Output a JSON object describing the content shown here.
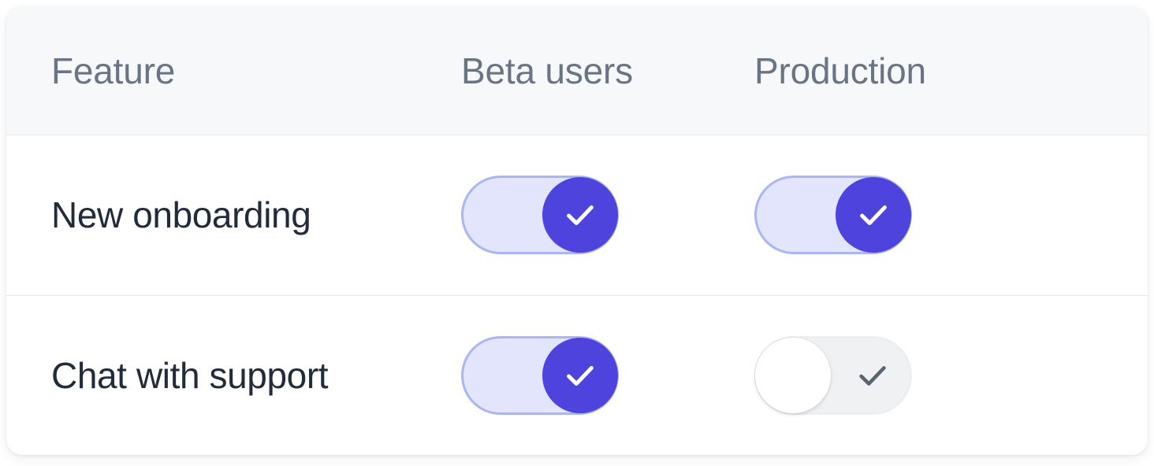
{
  "table": {
    "columns": [
      {
        "key": "feature",
        "label": "Feature"
      },
      {
        "key": "beta",
        "label": "Beta users"
      },
      {
        "key": "production",
        "label": "Production"
      }
    ],
    "rows": [
      {
        "feature": "New onboarding",
        "beta": {
          "state": "on",
          "icon": "check-icon"
        },
        "production": {
          "state": "on",
          "icon": "check-icon"
        }
      },
      {
        "feature": "Chat with support",
        "beta": {
          "state": "on",
          "icon": "check-icon"
        },
        "production": {
          "state": "off",
          "icon": "check-icon"
        }
      }
    ]
  },
  "colors": {
    "card_background": "#ffffff",
    "header_background": "#f7f8fa",
    "divider": "#e4e6eb",
    "header_text": "#6b7484",
    "feature_text": "#222b3a",
    "toggle_on_track": "#e2e5fb",
    "toggle_on_border": "#aab5f2",
    "toggle_on_knob": "#4f43dd",
    "toggle_on_check": "#ffffff",
    "toggle_off_track": "#f0f1f3",
    "toggle_off_knob": "#ffffff",
    "toggle_off_check": "#5a6472"
  }
}
